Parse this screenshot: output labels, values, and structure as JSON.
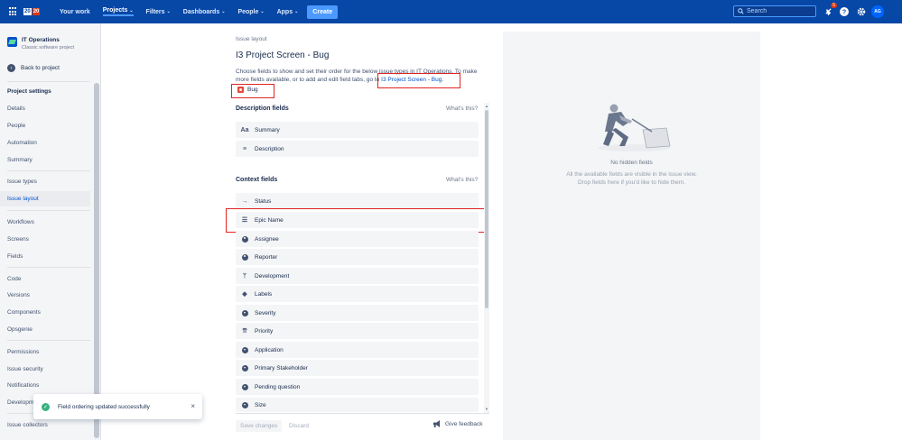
{
  "topnav": {
    "logo": [
      "20",
      "20"
    ],
    "items": [
      {
        "label": "Your work",
        "chevron": false
      },
      {
        "label": "Projects",
        "chevron": true
      },
      {
        "label": "Filters",
        "chevron": true
      },
      {
        "label": "Dashboards",
        "chevron": true
      },
      {
        "label": "People",
        "chevron": true
      },
      {
        "label": "Apps",
        "chevron": true
      }
    ],
    "create_label": "Create",
    "search_placeholder": "Search",
    "notification_count": "5",
    "avatar_initials": "AG"
  },
  "sidebar": {
    "project_name": "IT Operations",
    "project_type": "Classic software project",
    "back_label": "Back to project",
    "items": [
      {
        "label": "Project settings"
      },
      {
        "label": "Details"
      },
      {
        "label": "People"
      },
      {
        "label": "Automation"
      },
      {
        "label": "Summary"
      },
      {
        "label": "Issue types"
      },
      {
        "label": "Issue layout"
      },
      {
        "label": "Workflows"
      },
      {
        "label": "Screens"
      },
      {
        "label": "Fields"
      },
      {
        "label": "Code"
      },
      {
        "label": "Versions"
      },
      {
        "label": "Components"
      },
      {
        "label": "Opsgenie"
      },
      {
        "label": "Permissions"
      },
      {
        "label": "Issue security"
      },
      {
        "label": "Notifications"
      },
      {
        "label": "Development tools"
      },
      {
        "label": "Issue collectors"
      }
    ]
  },
  "main": {
    "breadcrumb": "Issue layout",
    "title": "I3 Project Screen - Bug",
    "intro_text": "Choose fields to show and set their order for the below issue types in IT Operations. To make more fields available, or to add and edit field tabs, go to ",
    "intro_link": "I3 Project Screen - Bug",
    "intro_end": ".",
    "issue_type": "Bug",
    "whats_this": "What's this?",
    "description_title": "Description fields",
    "description_fields": [
      "Summary",
      "Description"
    ],
    "context_title": "Context fields",
    "context_fields": [
      "Status",
      "Epic Name",
      "Assignee",
      "Reporter",
      "Development",
      "Labels",
      "Severity",
      "Priority",
      "Application",
      "Primary Stakeholder",
      "Pending question",
      "Size"
    ],
    "save_label": "Save changes",
    "discard_label": "Discard",
    "feedback_label": "Give feedback"
  },
  "hidden_panel": {
    "title": "No hidden fields",
    "desc_line1": "All the available fields are visible in the issue view.",
    "desc_line2": "Drop fields here if you'd like to hide them."
  },
  "toast": {
    "message": "Field ordering updated successfully"
  }
}
